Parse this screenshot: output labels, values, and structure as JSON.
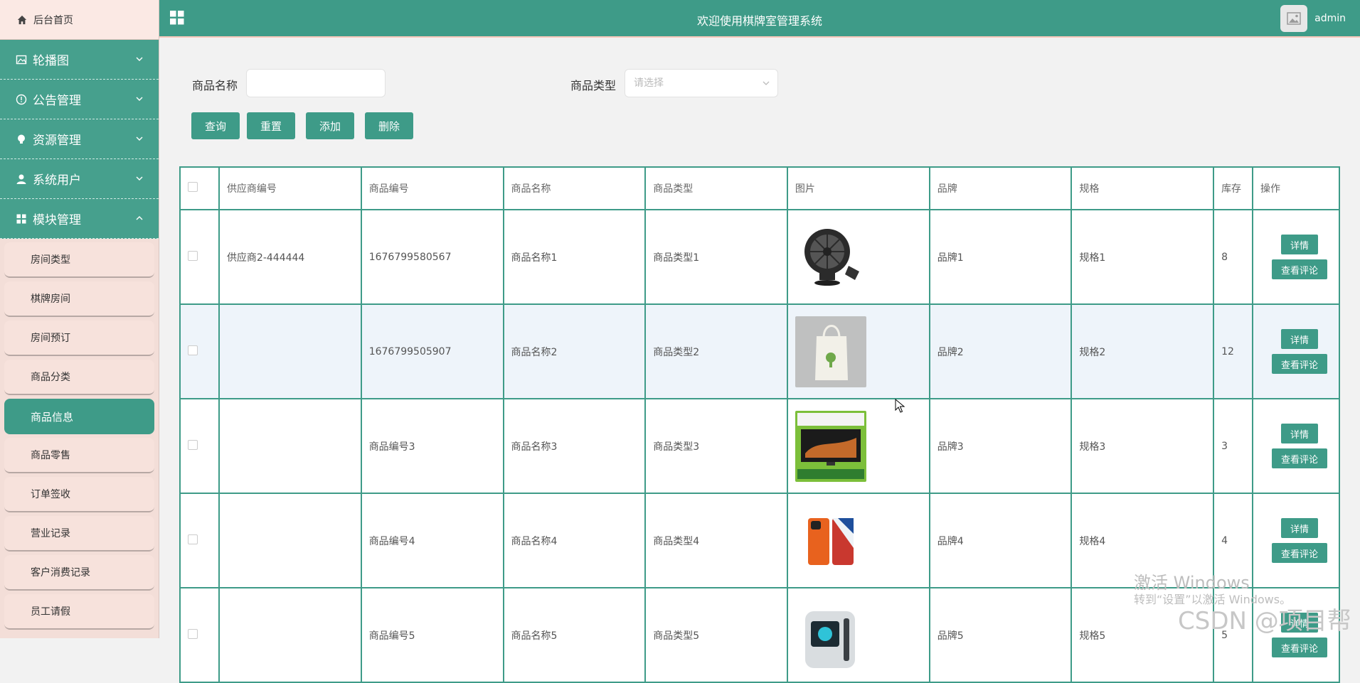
{
  "header": {
    "title": "欢迎使用棋牌室管理系统",
    "user": "admin"
  },
  "sidebar": {
    "home": "后台首页",
    "menus": [
      {
        "label": "轮播图",
        "icon": "image-icon"
      },
      {
        "label": "公告管理",
        "icon": "info-icon"
      },
      {
        "label": "资源管理",
        "icon": "bulb-icon"
      },
      {
        "label": "系统用户",
        "icon": "user-icon"
      },
      {
        "label": "模块管理",
        "icon": "grid-icon"
      }
    ],
    "subs": [
      "房间类型",
      "棋牌房间",
      "房间预订",
      "商品分类",
      "商品信息",
      "商品零售",
      "订单签收",
      "营业记录",
      "客户消费记录",
      "员工请假"
    ]
  },
  "search": {
    "name_label": "商品名称",
    "name_value": "",
    "type_label": "商品类型",
    "type_placeholder": "请选择"
  },
  "buttons": {
    "query": "查询",
    "reset": "重置",
    "add": "添加",
    "delete": "删除"
  },
  "table": {
    "columns": [
      "供应商编号",
      "商品编号",
      "商品名称",
      "商品类型",
      "图片",
      "品牌",
      "规格",
      "库存",
      "操作"
    ],
    "rows": [
      {
        "supplier": "供应商2-444444",
        "code": "1676799580567",
        "name": "商品名称1",
        "type": "商品类型1",
        "image": "fan",
        "brand": "品牌1",
        "spec": "规格1",
        "stock": "8"
      },
      {
        "supplier": "",
        "code": "1676799505907",
        "name": "商品名称2",
        "type": "商品类型2",
        "image": "bag",
        "brand": "品牌2",
        "spec": "规格2",
        "stock": "12"
      },
      {
        "supplier": "",
        "code": "商品编号3",
        "name": "商品名称3",
        "type": "商品类型3",
        "image": "tv",
        "brand": "品牌3",
        "spec": "规格3",
        "stock": "3"
      },
      {
        "supplier": "",
        "code": "商品编号4",
        "name": "商品名称4",
        "type": "商品类型4",
        "image": "phone",
        "brand": "品牌4",
        "spec": "规格4",
        "stock": "4"
      },
      {
        "supplier": "",
        "code": "商品编号5",
        "name": "商品名称5",
        "type": "商品类型5",
        "image": "device",
        "brand": "品牌5",
        "spec": "规格5",
        "stock": "5"
      }
    ],
    "detail_label": "详情",
    "comment_label": "查看评论"
  },
  "watermark": {
    "line1": "激活 Windows",
    "line2": "转到“设置”以激活 Windows。",
    "csdn": "CSDN @项目帮"
  },
  "colors": {
    "primary": "#3e9b88",
    "sidebar_bg": "#f3ded8"
  }
}
